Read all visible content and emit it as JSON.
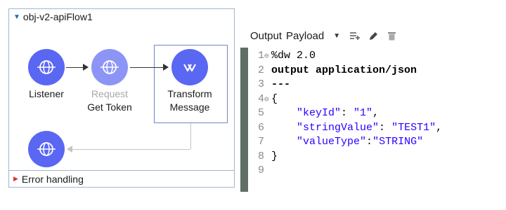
{
  "flow": {
    "title": "obj-v2-apiFlow1",
    "nodes": [
      {
        "id": "listener",
        "label_line1": "Listener",
        "label_line2": ""
      },
      {
        "id": "request",
        "label_line1": "Request",
        "label_line2": "Get Token"
      },
      {
        "id": "transform",
        "label_line1": "Transform",
        "label_line2": "Message"
      }
    ],
    "error_handling": "Error handling"
  },
  "editor": {
    "output_label": "Output",
    "payload_label": "Payload",
    "lines": [
      {
        "n": "1",
        "fold": true,
        "tokens": [
          {
            "t": "%dw 2.0",
            "c": "plain"
          }
        ]
      },
      {
        "n": "2",
        "fold": false,
        "tokens": [
          {
            "t": "output application/json",
            "c": "kw"
          }
        ]
      },
      {
        "n": "3",
        "fold": false,
        "tokens": [
          {
            "t": "---",
            "c": "kw"
          }
        ]
      },
      {
        "n": "4",
        "fold": true,
        "tokens": [
          {
            "t": "{",
            "c": "plain"
          }
        ]
      },
      {
        "n": "5",
        "fold": false,
        "tokens": [
          {
            "t": "    ",
            "c": "plain"
          },
          {
            "t": "\"keyId\"",
            "c": "key"
          },
          {
            "t": ": ",
            "c": "plain"
          },
          {
            "t": "\"1\"",
            "c": "str"
          },
          {
            "t": ",",
            "c": "plain"
          }
        ]
      },
      {
        "n": "6",
        "fold": false,
        "tokens": [
          {
            "t": "    ",
            "c": "plain"
          },
          {
            "t": "\"stringValue\"",
            "c": "key"
          },
          {
            "t": ": ",
            "c": "plain"
          },
          {
            "t": "\"TEST1\"",
            "c": "str"
          },
          {
            "t": ",",
            "c": "plain"
          }
        ]
      },
      {
        "n": "7",
        "fold": false,
        "tokens": [
          {
            "t": "    ",
            "c": "plain"
          },
          {
            "t": "\"valueType\"",
            "c": "key"
          },
          {
            "t": ":",
            "c": "plain"
          },
          {
            "t": "\"STRING\"",
            "c": "str"
          }
        ]
      },
      {
        "n": "8",
        "fold": false,
        "tokens": [
          {
            "t": "}",
            "c": "plain"
          }
        ]
      },
      {
        "n": "9",
        "fold": false,
        "tokens": []
      }
    ]
  },
  "colors": {
    "node": "#5a67f3",
    "node_disabled": "#8c95f5",
    "string": "#2a00ff",
    "gutter": "#5f6f66"
  }
}
